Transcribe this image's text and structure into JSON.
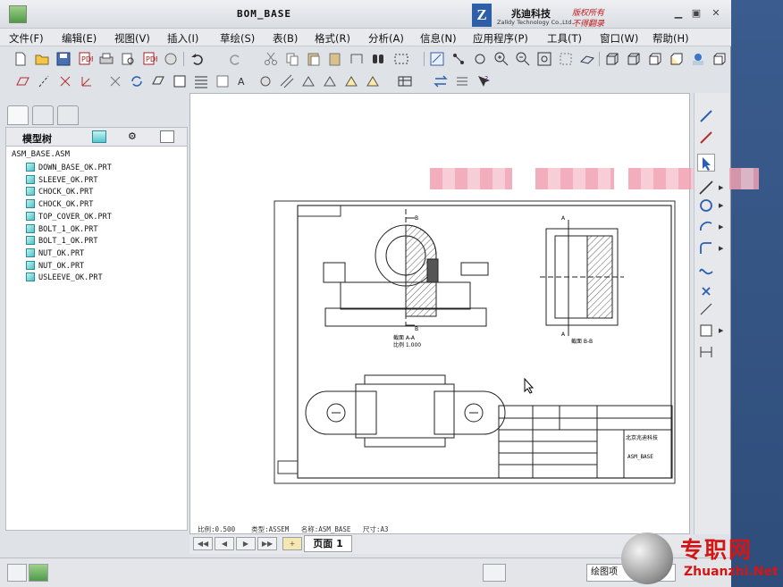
{
  "window": {
    "title": "BOM_BASE",
    "logo_mark": "Z",
    "logo_cn": "兆迪科技",
    "logo_en": "Zalldy Technology Co.,Ltd.",
    "logo_slogan_1": "版权所有",
    "logo_slogan_2": "不得翻录"
  },
  "menu": [
    "文件(F)",
    "编辑(E)",
    "视图(V)",
    "插入(I)",
    "草绘(S)",
    "表(B)",
    "格式(R)",
    "分析(A)",
    "信息(N)",
    "应用程序(P)",
    "工具(T)",
    "窗口(W)",
    "帮助(H)"
  ],
  "tree": {
    "title": "模型树",
    "root": "ASM_BASE.ASM",
    "items": [
      "DOWN_BASE_OK.PRT",
      "SLEEVE_OK.PRT",
      "CHOCK_OK.PRT",
      "CHOCK_OK.PRT",
      "TOP_COVER_OK.PRT",
      "BOLT_1_OK.PRT",
      "BOLT_1_OK.PRT",
      "NUT_OK.PRT",
      "NUT_OK.PRT",
      "USLEEVE_OK.PRT"
    ]
  },
  "drawing": {
    "section_aa": "截面 A-A",
    "scale_aa": "比例 1.000",
    "section_bb": "截面 B-B",
    "title_block_name": "ASM_BASE",
    "title_block_org": "北京兆迪科技",
    "label_a": "A",
    "label_b": "B"
  },
  "status": {
    "scale": "比例:0.500",
    "type": "类型:ASSEM",
    "name": "名称:ASM_BASE",
    "size": "尺寸:A3"
  },
  "page_tab": "页面 1",
  "bottom_dropdown": "绘图项",
  "watermark": {
    "cn": "专职网",
    "en": "Zhuanzhi.Net"
  },
  "colors": {
    "desktop": "#3d5f8f",
    "accent_red": "#d21616",
    "logo_blue": "#2e5ea8"
  }
}
